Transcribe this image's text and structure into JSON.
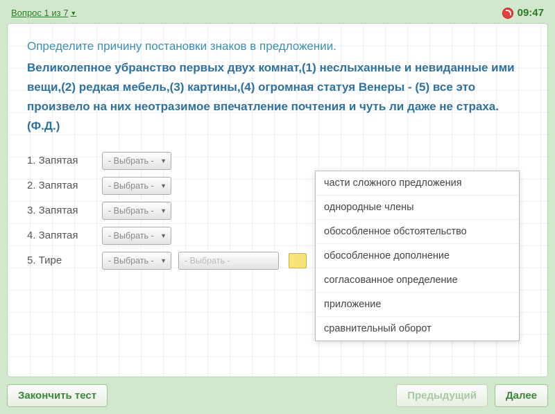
{
  "header": {
    "question_link": "Вопрос 1 из 7",
    "time": "09:47"
  },
  "instruction": "Определите причину постановки знаков в предложении.",
  "sentence": "Великолепное убранство первых двух комнат,(1) неслыханные и невиданные ими вещи,(2) редкая мебель,(3) картины,(4) огромная статуя Венеры - (5) все это произвело на них неотразимое впечатление почтения и чуть ли даже не страха. (Ф.Д.)",
  "items": [
    {
      "label": "1. Запятая",
      "placeholder": "- Выбрать -"
    },
    {
      "label": "2. Запятая",
      "placeholder": "- Выбрать -"
    },
    {
      "label": "3. Запятая",
      "placeholder": "- Выбрать -"
    },
    {
      "label": "4. Запятая",
      "placeholder": "- Выбрать -"
    },
    {
      "label": "5. Тире",
      "placeholder": "- Выбрать -"
    }
  ],
  "ghost_select": "- Выбрать -",
  "dropdown_options": [
    "части сложного предложения",
    "однородные члены",
    "обособленное обстоятельство",
    "обособленное дополнение",
    "согласованное определение",
    "приложение",
    "сравнительный оборот"
  ],
  "footer": {
    "finish": "Закончить тест",
    "prev": "Предыдущий",
    "next": "Далее"
  }
}
